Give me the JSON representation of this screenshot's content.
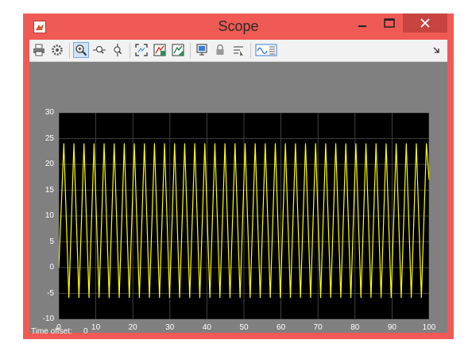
{
  "window": {
    "title": "Scope",
    "minimize_icon": "minimize-icon",
    "maximize_icon": "maximize-icon",
    "close_icon": "close-icon"
  },
  "toolbar": {
    "icons": [
      "print-icon",
      "gear-icon",
      "zoom-in-icon",
      "zoom-x-icon",
      "zoom-y-icon",
      "autoscale-icon",
      "save-axes-limits-icon",
      "restore-axes-limits-icon",
      "floating-scope-icon",
      "lock-icon",
      "signal-selection-icon",
      "parameters-icon",
      "toolbar-dropdown-icon"
    ]
  },
  "status": {
    "time_offset_label": "Time offset:",
    "time_offset_value": "0"
  },
  "colors": {
    "window_frame": "#f05a55",
    "plot_bg": "#000000",
    "figure_bg": "#808080",
    "signal": "#ffff00",
    "grid": "#505050"
  },
  "chart_data": {
    "type": "line",
    "title": "",
    "xlabel": "",
    "ylabel": "",
    "xlim": [
      0,
      100
    ],
    "ylim": [
      -10,
      30
    ],
    "grid": true,
    "x_ticks": [
      "0",
      "10",
      "20",
      "30",
      "40",
      "50",
      "60",
      "70",
      "80",
      "90",
      "100"
    ],
    "y_ticks": [
      "30",
      "25",
      "20",
      "15",
      "10",
      "5",
      "0",
      "-5",
      "-10"
    ],
    "series": [
      {
        "color": "#ffff00",
        "x": [
          0,
          1.36,
          2.72,
          4.08,
          5.44,
          6.8,
          8.16,
          9.52,
          10.88,
          12.24,
          13.6,
          14.96,
          16.32,
          17.68,
          19.04,
          20.4,
          21.76,
          23.12,
          24.48,
          25.84,
          27.2,
          28.56,
          29.92,
          31.28,
          32.64,
          34,
          35.36,
          36.72,
          38.08,
          39.44,
          40.8,
          42.16,
          43.52,
          44.88,
          46.24,
          47.6,
          48.96,
          50.32,
          51.68,
          53.04,
          54.4,
          55.76,
          57.12,
          58.48,
          59.84,
          61.2,
          62.56,
          63.92,
          65.28,
          66.64,
          68,
          69.36,
          70.72,
          72.08,
          73.44,
          74.8,
          76.16,
          77.52,
          78.88,
          80.24,
          81.6,
          82.96,
          84.32,
          85.68,
          87.04,
          88.4,
          89.76,
          91.12,
          92.48,
          93.84,
          95.2,
          96.56,
          97.92,
          99.28,
          100
        ],
        "y": [
          0,
          24,
          -5.8,
          24,
          -5.8,
          24,
          -5.8,
          24,
          -5.8,
          24,
          -5.8,
          24,
          -5.8,
          24,
          -5.8,
          24,
          -5.8,
          24,
          -5.8,
          24,
          -5.8,
          24,
          -5.8,
          24,
          -5.8,
          24,
          -5.8,
          24,
          -5.8,
          24,
          -5.8,
          24,
          -5.8,
          24,
          -5.8,
          24,
          -5.8,
          24,
          -5.8,
          24,
          -5.8,
          24,
          -5.8,
          24,
          -5.8,
          24,
          -5.8,
          24,
          -5.8,
          24,
          -5.8,
          24,
          -5.8,
          24,
          -5.8,
          24,
          -5.8,
          24,
          -5.8,
          24,
          -5.8,
          24,
          -5.8,
          24,
          -5.8,
          24,
          -5.8,
          24,
          -5.8,
          24,
          -5.8,
          24,
          -5.8,
          24,
          17
        ]
      }
    ]
  }
}
